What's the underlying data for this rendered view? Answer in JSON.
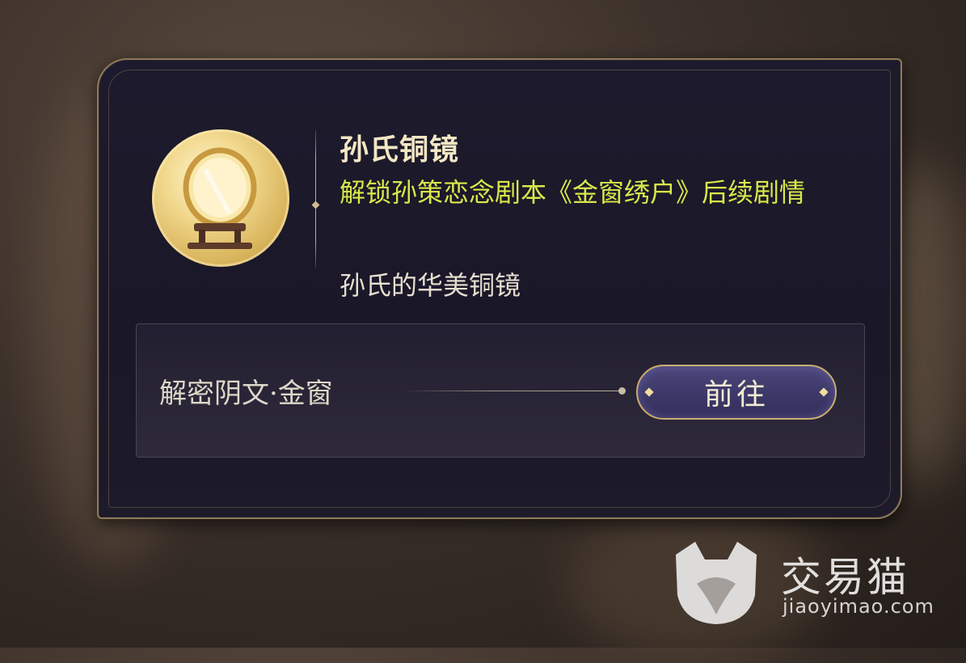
{
  "item": {
    "name": "孙氏铜镜",
    "effect": "解锁孙策恋念剧本《金窗绣户》后续剧情",
    "description": "孙氏的华美铜镜",
    "icon": "bronze-mirror-icon"
  },
  "source": {
    "label": "解密阴文·金窗",
    "button_label": "前往"
  },
  "watermark": {
    "name": "交易猫",
    "url": "jiaoyimao.com"
  },
  "colors": {
    "title": "#f3e7c4",
    "effect": "#d9e84a",
    "description": "#e6dfcf",
    "panel_bg": "#1c1a2c",
    "border_gold": "#8f7a57",
    "button_bg": "#3c3868"
  }
}
